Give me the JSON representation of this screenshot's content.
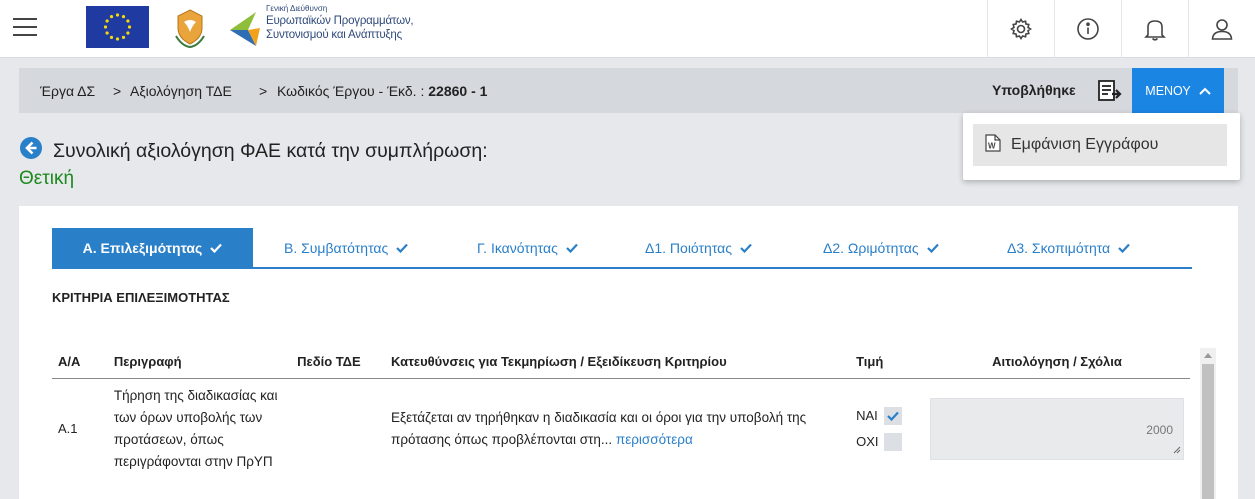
{
  "header": {
    "agency_small": "Γενική Διεύθυνση",
    "agency_line1": "Ευρωπαϊκών Προγραμμάτων,",
    "agency_line2": "Συντονισμού και Ανάπτυξης",
    "icons": [
      "settings-icon",
      "info-icon",
      "bell-icon",
      "user-icon"
    ]
  },
  "breadcrumb": {
    "item1": "Έργα ΔΣ",
    "item2": "Αξιολόγηση ΤΔΕ",
    "item3_prefix": "Κωδικός Έργου - Έκδ. :",
    "item3_code": "22860 - 1",
    "separator": ">",
    "status": "Υποβλήθηκε",
    "menu_label": "ΜΕΝΟΥ"
  },
  "dropdown": {
    "item_label": "Εμφάνιση Εγγράφου"
  },
  "page": {
    "title": "Συνολική αξιολόγηση ΦΑΕ κατά την συμπλήρωση:",
    "result": "Θετική"
  },
  "tabs": [
    {
      "label": "Α. Επιλεξιμότητας",
      "active": true
    },
    {
      "label": "Β. Συμβατότητας",
      "active": false
    },
    {
      "label": "Γ. Ικανότητας",
      "active": false
    },
    {
      "label": "Δ1. Ποιότητας",
      "active": false
    },
    {
      "label": "Δ2. Ωριμότητας",
      "active": false
    },
    {
      "label": "Δ3. Σκοπιμότητα",
      "active": false
    }
  ],
  "section": {
    "title": "ΚΡΙΤΗΡΙΑ ΕΠΙΛΕΞΙΜΟΤΗΤΑΣ"
  },
  "table": {
    "columns": [
      "Α/Α",
      "Περιγραφή",
      "Πεδίο ΤΔΕ",
      "Κατευθύνσεις για Τεκμηρίωση / Εξειδίκευση Κριτηρίου",
      "Τιμή",
      "Αιτιολόγηση / Σχόλια"
    ],
    "rows": [
      {
        "id": "Α.1",
        "description": "Τήρηση της διαδικασίας και των όρων υποβολής των προτάσεων, όπως περιγράφονται στην ΠρΥΠ",
        "field": "",
        "guidance": "Εξετάζεται αν τηρήθηκαν η διαδικασία και οι όροι για την υποβολή της πρότασης όπως προβλέπονται στη...",
        "more_link": "περισσότερα",
        "yes_label": "ΝΑΙ",
        "yes_checked": true,
        "no_label": "ΟΧΙ",
        "no_checked": false,
        "comment_remaining": "2000"
      }
    ]
  },
  "colors": {
    "accent": "#2a7fc9",
    "menu_button": "#1b85e3",
    "result_green": "#1d8a1d"
  }
}
